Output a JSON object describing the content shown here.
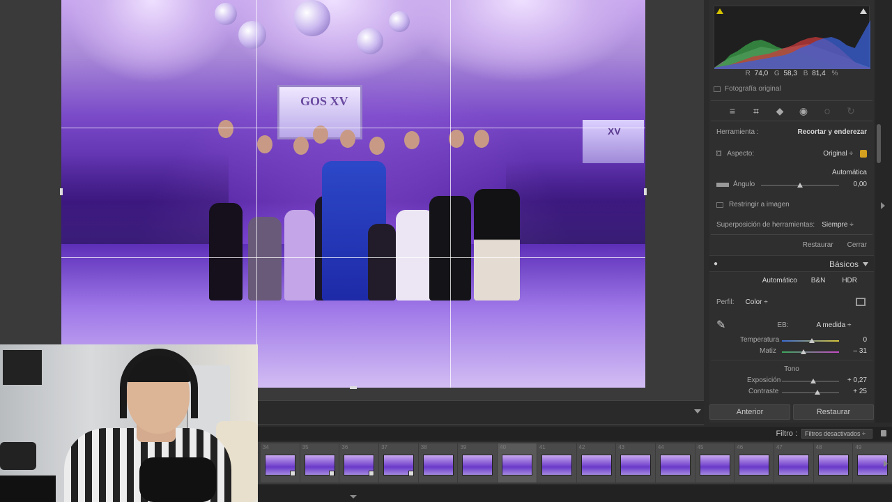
{
  "histogram": {
    "r_label": "R",
    "r_value": "74,0",
    "g_label": "G",
    "g_value": "58,3",
    "b_label": "B",
    "b_value": "81,4",
    "unit": "%"
  },
  "original_photo_label": "Fotografía original",
  "crop_tool": {
    "herramienta_label": "Herramienta :",
    "herramienta_value": "Recortar y enderezar",
    "aspecto_label": "Aspecto:",
    "aspecto_value": "Original ÷",
    "automatica_label": "Automática",
    "angulo_label": "Ángulo",
    "angulo_value": "0,00",
    "restringir_label": "Restringir a imagen",
    "superposicion_label": "Superposición de herramientas:",
    "superposicion_value": "Siempre ÷",
    "restaurar_label": "Restaurar",
    "cerrar_label": "Cerrar"
  },
  "basicos": {
    "title": "Básicos",
    "tabs": [
      "Automático",
      "B&N",
      "HDR"
    ],
    "perfil_label": "Perfil:",
    "perfil_value": "Color ÷",
    "eb_label": "EB:",
    "eb_value": "A medida ÷",
    "temperatura_label": "Temperatura",
    "temperatura_value": "0",
    "matiz_label": "Matiz",
    "matiz_value": "– 31",
    "tono_label": "Tono",
    "exposicion_label": "Exposición",
    "exposicion_value": "+ 0,27",
    "contraste_label": "Contraste",
    "contraste_value": "+ 25"
  },
  "bottom_buttons": {
    "anterior": "Anterior",
    "restaurar": "Restaurar"
  },
  "filmstrip": {
    "filtro_label": "Filtro :",
    "filtro_value": "Filtros desactivados ÷",
    "cells": [
      {
        "num": "34",
        "badge": true
      },
      {
        "num": "35",
        "badge": true
      },
      {
        "num": "36",
        "badge": true
      },
      {
        "num": "37",
        "badge": true
      },
      {
        "num": "38",
        "badge": false
      },
      {
        "num": "39",
        "badge": false
      },
      {
        "num": "40",
        "badge": false
      },
      {
        "num": "41",
        "badge": false
      },
      {
        "num": "42",
        "badge": false
      },
      {
        "num": "43",
        "badge": false
      },
      {
        "num": "44",
        "badge": false
      },
      {
        "num": "45",
        "badge": false
      },
      {
        "num": "46",
        "badge": false
      },
      {
        "num": "47",
        "badge": false
      },
      {
        "num": "48",
        "badge": false
      },
      {
        "num": "49",
        "badge": false
      }
    ]
  },
  "photo": {
    "screen_text": "GOS XV",
    "screen2_text": "XV"
  },
  "colors": {
    "panel_bg": "#2f2f2f",
    "accent_highlight": "#d4c200"
  },
  "sliders": {
    "angulo_fraction": 0.5,
    "temperatura_fraction": 0.52,
    "matiz_fraction": 0.38,
    "exposicion_fraction": 0.55,
    "contraste_fraction": 0.62
  }
}
